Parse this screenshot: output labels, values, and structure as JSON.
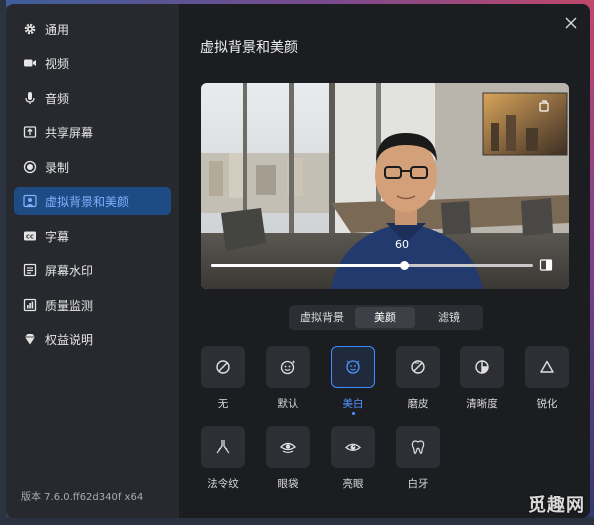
{
  "sidebar": {
    "items": [
      {
        "label": "通用",
        "icon": "gear-icon"
      },
      {
        "label": "视频",
        "icon": "video-camera-icon"
      },
      {
        "label": "音频",
        "icon": "microphone-icon"
      },
      {
        "label": "共享屏幕",
        "icon": "share-screen-icon"
      },
      {
        "label": "录制",
        "icon": "record-icon"
      },
      {
        "label": "虚拟背景和美颜",
        "icon": "virtual-background-icon",
        "active": true
      },
      {
        "label": "字幕",
        "icon": "captions-icon"
      },
      {
        "label": "屏幕水印",
        "icon": "watermark-icon"
      },
      {
        "label": "质量监测",
        "icon": "quality-monitor-icon"
      },
      {
        "label": "权益说明",
        "icon": "diamond-icon"
      }
    ],
    "version": "版本 7.6.0.ff62d340f x64"
  },
  "main": {
    "title": "虚拟背景和美颜",
    "slider": {
      "value": 60,
      "max": 100
    }
  },
  "tabs": [
    {
      "label": "虚拟背景"
    },
    {
      "label": "美颜",
      "active": true
    },
    {
      "label": "滤镜"
    }
  ],
  "effects": [
    {
      "label": "无",
      "icon": "none-icon"
    },
    {
      "label": "默认",
      "icon": "smile-sparkle-icon"
    },
    {
      "label": "美白",
      "icon": "face-whitening-icon",
      "active": true
    },
    {
      "label": "磨皮",
      "icon": "smooth-skin-icon"
    },
    {
      "label": "清晰度",
      "icon": "sharpness-icon"
    },
    {
      "label": "锐化",
      "icon": "sharpen-triangle-icon"
    },
    {
      "label": "法令纹",
      "icon": "nasolabial-icon"
    },
    {
      "label": "眼袋",
      "icon": "eye-bag-icon"
    },
    {
      "label": "亮眼",
      "icon": "bright-eye-icon"
    },
    {
      "label": "白牙",
      "icon": "tooth-icon"
    }
  ],
  "watermark_text": "觅趣网",
  "colors": {
    "accent": "#3f8cff",
    "active_nav_bg": "#1e4b84",
    "window_bg": "#1b1d21",
    "sidebar_bg": "#27292e"
  }
}
